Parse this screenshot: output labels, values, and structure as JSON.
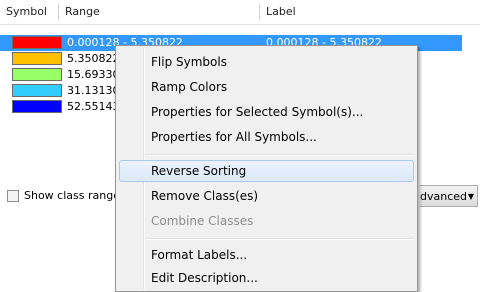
{
  "columns": {
    "symbol": "Symbol",
    "range": "Range",
    "label": "Label"
  },
  "rows": [
    {
      "color": "#ff0000",
      "range": "0.000128 - 5.350822",
      "label": "0.000128 - 5.350822",
      "selected": true
    },
    {
      "color": "#ffc000",
      "range": "5.350822",
      "label": "",
      "selected": false
    },
    {
      "color": "#99ff66",
      "range": "15.69330",
      "label": "",
      "selected": false
    },
    {
      "color": "#33ccff",
      "range": "31.13130",
      "label": "",
      "selected": false
    },
    {
      "color": "#0000ff",
      "range": "52.55143",
      "label": "",
      "selected": false
    }
  ],
  "footer": {
    "show_class_ranges": "Show class range",
    "advanced_label": "dvanced",
    "advanced_arrow": "▼"
  },
  "menu": {
    "flip_symbols": "Flip Symbols",
    "ramp_colors": "Ramp Colors",
    "props_selected": "Properties for Selected Symbol(s)...",
    "props_all": "Properties for All Symbols...",
    "reverse_sorting": "Reverse Sorting",
    "remove_classes": "Remove Class(es)",
    "combine_classes": "Combine Classes",
    "format_labels": "Format Labels...",
    "edit_description": "Edit Description..."
  }
}
